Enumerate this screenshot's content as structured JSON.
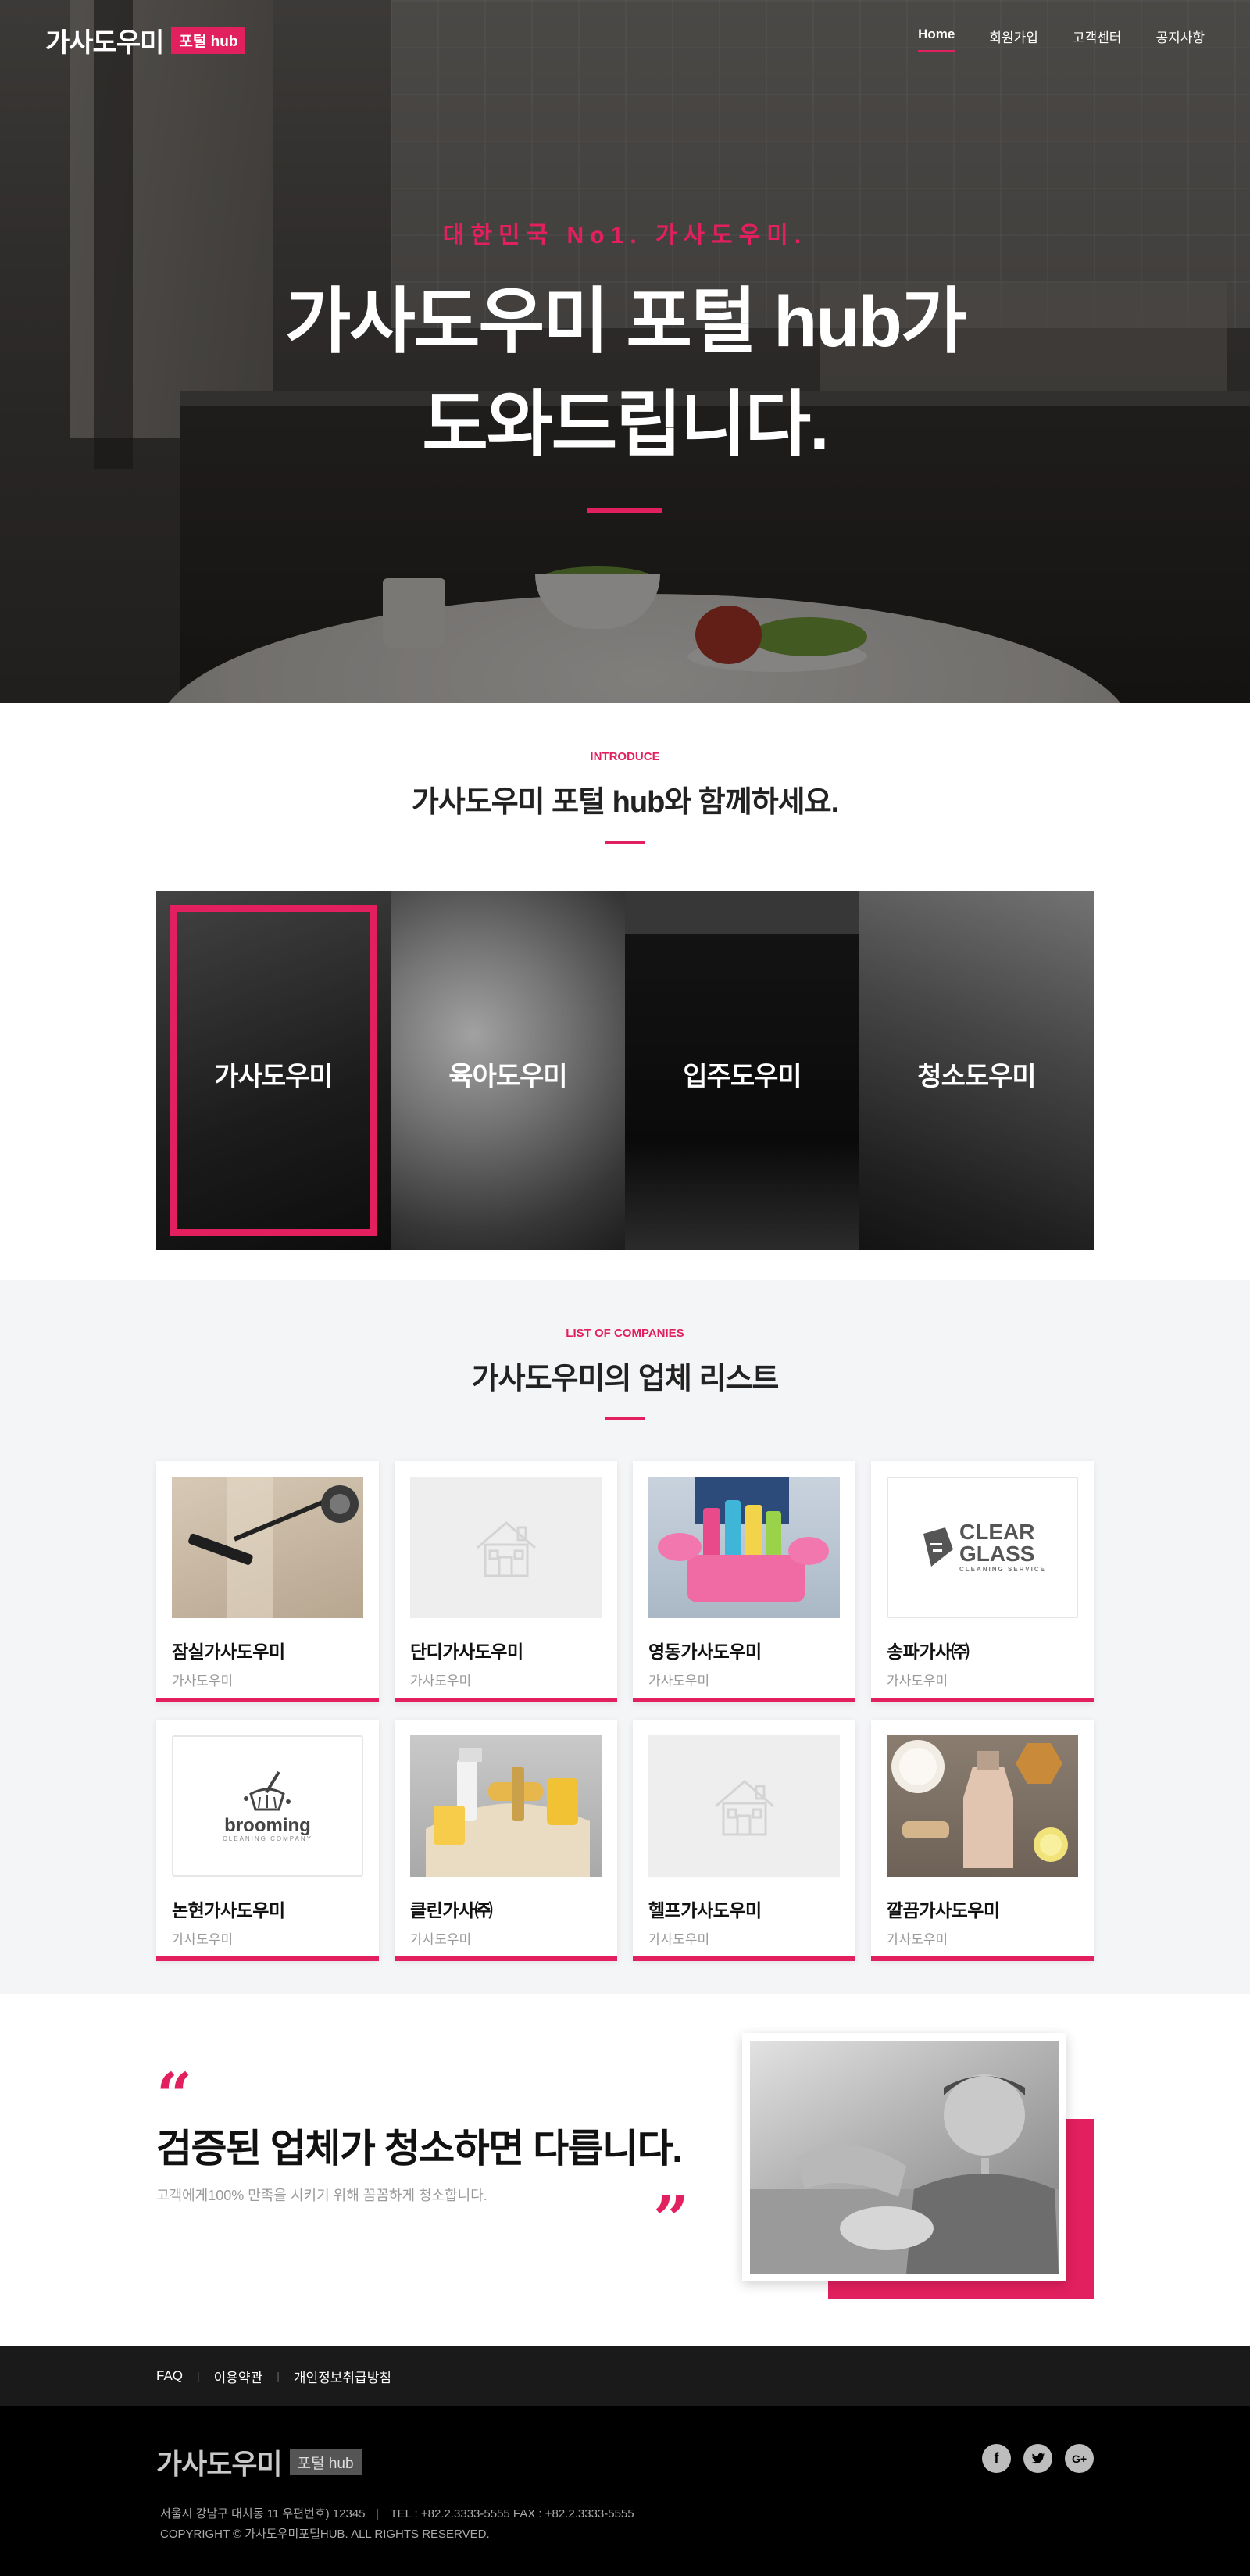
{
  "brand": {
    "name": "가사도우미",
    "badge": "포털 hub",
    "accent": "#e3205f"
  },
  "nav": {
    "items": [
      "Home",
      "회원가입",
      "고객센터",
      "공지사항"
    ],
    "active": "Home"
  },
  "hero": {
    "eyebrow": "대한민국 No1. 가사도우미.",
    "title_line1": "가사도우미 포털 hub가",
    "title_line2": "도와드립니다."
  },
  "intro": {
    "label": "INTRODUCE",
    "title": "가사도우미 포털 hub와 함께하세요.",
    "services": [
      "가사도우미",
      "육아도우미",
      "입주도우미",
      "청소도우미"
    ],
    "selected": "가사도우미"
  },
  "companies": {
    "label": "LIST OF COMPANIES",
    "title": "가사도우미의 업체 리스트",
    "items": [
      {
        "name": "잠실가사도우미",
        "sub": "가사도우미",
        "thumb": "vacuum-photo"
      },
      {
        "name": "단디가사도우미",
        "sub": "가사도우미",
        "thumb": "house-placeholder"
      },
      {
        "name": "영동가사도우미",
        "sub": "가사도우미",
        "thumb": "supplies-photo"
      },
      {
        "name": "송파가사㈜",
        "sub": "가사도우미",
        "thumb": "clear-glass-logo"
      },
      {
        "name": "논현가사도우미",
        "sub": "가사도우미",
        "thumb": "brooming-logo"
      },
      {
        "name": "클린가사㈜",
        "sub": "가사도우미",
        "thumb": "caddy-photo"
      },
      {
        "name": "헬프가사도우미",
        "sub": "가사도우미",
        "thumb": "house-placeholder"
      },
      {
        "name": "깔끔가사도우미",
        "sub": "가사도우미",
        "thumb": "natural-products-photo"
      }
    ],
    "logo_clear_glass": {
      "line1": "CLEAR",
      "line2": "GLASS",
      "tag": "CLEANING SERVICE"
    },
    "logo_brooming": {
      "word": "brooming",
      "tag": "CLEANING COMPANY"
    }
  },
  "testimonial": {
    "title": "검증된 업체가 청소하면 다릅니다.",
    "subtitle": "고객에게100% 만족을 시키기 위해 꼼꼼하게 청소합니다.",
    "quote_open": "“",
    "quote_close": "”"
  },
  "footer": {
    "links": [
      "FAQ",
      "이용약관",
      "개인정보취급방침"
    ],
    "logo_name": "가사도우미",
    "logo_badge": "포털 hub",
    "address": "서울시 강남구 대치동 11 우편번호) 12345",
    "phone": "TEL : +82.2.3333-5555  FAX : +82.2.3333-5555",
    "copyright": "COPYRIGHT © 가사도우미포털HUB. ALL RIGHTS RESERVED.",
    "social": [
      "facebook-icon",
      "twitter-icon",
      "google-plus-icon"
    ]
  }
}
